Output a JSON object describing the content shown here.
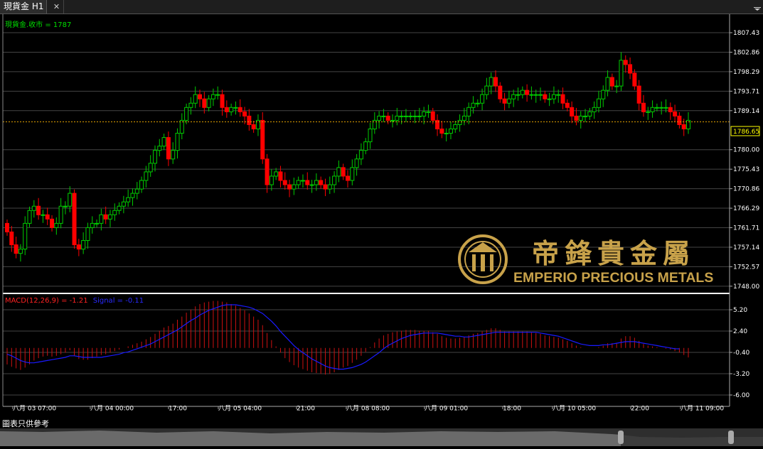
{
  "tab": {
    "title": "現貨金 H1"
  },
  "price_panel": {
    "series_label": "現貨金.收市 = 1787",
    "y_ticks": [
      "1807.43",
      "1802.86",
      "1798.29",
      "1793.71",
      "1789.14",
      "1780.00",
      "1775.43",
      "1770.86",
      "1766.29",
      "1761.71",
      "1757.14",
      "1752.57",
      "1748.00"
    ],
    "current_price": "1786.65"
  },
  "macd_panel": {
    "macd_label": "MACD(12,26,9) = -1.21",
    "signal_label": "Signal = -0.11",
    "y_ticks": [
      "5.20",
      "2.40",
      "-0.40",
      "-3.20",
      "-6.00"
    ]
  },
  "x_ticks": [
    "八月 03 07:00",
    "八月 04 00:00",
    "17:00",
    "八月 05 04:00",
    "21:00",
    "八月 08 08:00",
    "八月 09 01:00",
    "18:00",
    "八月 10 05:00",
    "22:00",
    "八月 11 09:00"
  ],
  "watermark": {
    "chinese": "帝鋒貴金屬",
    "english": "EMPERIO PRECIOUS METALS"
  },
  "footer_note": "圖表只供參考",
  "colors": {
    "up": "#00cc00",
    "down": "#ff0000",
    "macd_hist": "#cc1111",
    "signal": "#1a1aff",
    "accent": "#ffff00",
    "gold": "#c8a24a"
  },
  "chart_data": [
    {
      "type": "candlestick",
      "title": "現貨金 H1",
      "ylim": [
        1748.0,
        1809.0
      ],
      "close": [
        1761,
        1758,
        1756,
        1757,
        1763,
        1766,
        1767,
        1765,
        1765,
        1764,
        1762,
        1763,
        1767,
        1767,
        1770,
        1758,
        1757,
        1759,
        1762,
        1763,
        1763,
        1765,
        1764,
        1765,
        1766,
        1767,
        1768,
        1769,
        1770,
        1771,
        1773,
        1775,
        1777,
        1780,
        1781,
        1783,
        1778,
        1780,
        1784,
        1787,
        1790,
        1791,
        1793,
        1792,
        1790,
        1792,
        1793,
        1793,
        1790,
        1789,
        1790,
        1790,
        1789,
        1788,
        1786,
        1785,
        1787,
        1778,
        1772,
        1774,
        1775,
        1773,
        1772,
        1771,
        1772,
        1773,
        1773,
        1772,
        1772,
        1773,
        1772,
        1771,
        1772,
        1774,
        1776,
        1774,
        1773,
        1776,
        1778,
        1780,
        1782,
        1785,
        1787,
        1788,
        1788,
        1787,
        1787,
        1788,
        1788,
        1788,
        1788,
        1788,
        1788,
        1789,
        1789,
        1787,
        1785,
        1784,
        1784,
        1785,
        1786,
        1787,
        1788,
        1790,
        1791,
        1791,
        1793,
        1795,
        1797,
        1795,
        1792,
        1791,
        1792,
        1793,
        1793,
        1794,
        1793,
        1793,
        1793,
        1793,
        1792,
        1792,
        1793,
        1793,
        1791,
        1790,
        1788,
        1787,
        1788,
        1788,
        1789,
        1790,
        1792,
        1794,
        1797,
        1795,
        1795,
        1801,
        1800,
        1798,
        1795,
        1791,
        1789,
        1789,
        1790,
        1790,
        1790,
        1790,
        1789,
        1788,
        1786,
        1785,
        1787
      ]
    },
    {
      "type": "bar+line",
      "series": [
        {
          "name": "MACD(12,26,9)",
          "values": [
            -2.1,
            -2.4,
            -2.6,
            -2.8,
            -2.5,
            -2.1,
            -1.6,
            -1.3,
            -1.1,
            -1.0,
            -1.1,
            -1.0,
            -0.8,
            -0.6,
            -0.3,
            -1.0,
            -1.4,
            -1.5,
            -1.5,
            -1.3,
            -1.1,
            -0.9,
            -0.8,
            -0.6,
            -0.4,
            -0.2,
            0.0,
            0.2,
            0.4,
            0.6,
            0.8,
            1.1,
            1.4,
            1.8,
            2.2,
            2.6,
            2.8,
            3.1,
            3.6,
            4.0,
            4.5,
            4.9,
            5.3,
            5.6,
            5.8,
            5.9,
            6.0,
            6.0,
            5.9,
            5.8,
            5.6,
            5.4,
            5.1,
            4.8,
            4.4,
            4.0,
            3.6,
            2.9,
            1.9,
            1.0,
            0.2,
            -0.6,
            -1.3,
            -1.8,
            -2.2,
            -2.5,
            -2.7,
            -2.9,
            -3.1,
            -3.2,
            -3.3,
            -3.4,
            -3.3,
            -3.1,
            -2.8,
            -2.5,
            -2.3,
            -1.9,
            -1.5,
            -1.0,
            -0.5,
            0.1,
            0.7,
            1.2,
            1.6,
            1.8,
            2.0,
            2.1,
            2.2,
            2.3,
            2.3,
            2.3,
            2.2,
            2.2,
            2.2,
            2.0,
            1.8,
            1.5,
            1.3,
            1.2,
            1.2,
            1.3,
            1.4,
            1.6,
            1.8,
            1.9,
            2.1,
            2.3,
            2.5,
            2.5,
            2.3,
            2.1,
            2.1,
            2.1,
            2.1,
            2.1,
            2.1,
            2.0,
            1.9,
            1.8,
            1.6,
            1.5,
            1.4,
            1.3,
            1.1,
            0.9,
            0.6,
            0.3,
            0.1,
            0.0,
            0.0,
            0.0,
            0.1,
            0.3,
            0.6,
            0.6,
            0.6,
            1.2,
            1.5,
            1.5,
            1.3,
            0.9,
            0.5,
            0.3,
            0.2,
            0.1,
            0.0,
            -0.1,
            -0.2,
            -0.4,
            -0.6,
            -0.9,
            -1.21
          ]
        },
        {
          "name": "Signal",
          "values": [
            -0.8,
            -1.0,
            -1.3,
            -1.6,
            -1.8,
            -1.9,
            -1.9,
            -1.8,
            -1.7,
            -1.6,
            -1.5,
            -1.4,
            -1.3,
            -1.2,
            -1.0,
            -1.0,
            -1.1,
            -1.2,
            -1.2,
            -1.2,
            -1.2,
            -1.2,
            -1.1,
            -1.0,
            -0.9,
            -0.8,
            -0.6,
            -0.5,
            -0.3,
            -0.1,
            0.1,
            0.3,
            0.5,
            0.8,
            1.1,
            1.4,
            1.7,
            2.0,
            2.3,
            2.7,
            3.1,
            3.5,
            3.8,
            4.2,
            4.5,
            4.8,
            5.0,
            5.2,
            5.4,
            5.5,
            5.5,
            5.5,
            5.4,
            5.3,
            5.2,
            5.0,
            4.7,
            4.4,
            3.9,
            3.4,
            2.8,
            2.1,
            1.5,
            0.9,
            0.3,
            -0.2,
            -0.6,
            -1.0,
            -1.4,
            -1.7,
            -2.0,
            -2.3,
            -2.5,
            -2.6,
            -2.7,
            -2.7,
            -2.6,
            -2.5,
            -2.3,
            -2.1,
            -1.8,
            -1.4,
            -1.0,
            -0.6,
            -0.1,
            0.3,
            0.6,
            0.9,
            1.2,
            1.4,
            1.6,
            1.7,
            1.8,
            1.9,
            1.9,
            1.9,
            1.9,
            1.8,
            1.7,
            1.6,
            1.5,
            1.5,
            1.4,
            1.4,
            1.5,
            1.6,
            1.7,
            1.8,
            1.9,
            2.0,
            2.0,
            2.0,
            2.0,
            2.0,
            2.0,
            2.0,
            2.0,
            2.0,
            2.0,
            1.9,
            1.8,
            1.7,
            1.6,
            1.5,
            1.3,
            1.1,
            0.9,
            0.7,
            0.5,
            0.4,
            0.3,
            0.3,
            0.3,
            0.4,
            0.4,
            0.5,
            0.6,
            0.7,
            0.8,
            0.8,
            0.8,
            0.7,
            0.6,
            0.5,
            0.4,
            0.3,
            0.2,
            0.1,
            0.0,
            -0.1,
            -0.11
          ]
        }
      ],
      "ylim": [
        -6.0,
        6.5
      ]
    }
  ]
}
